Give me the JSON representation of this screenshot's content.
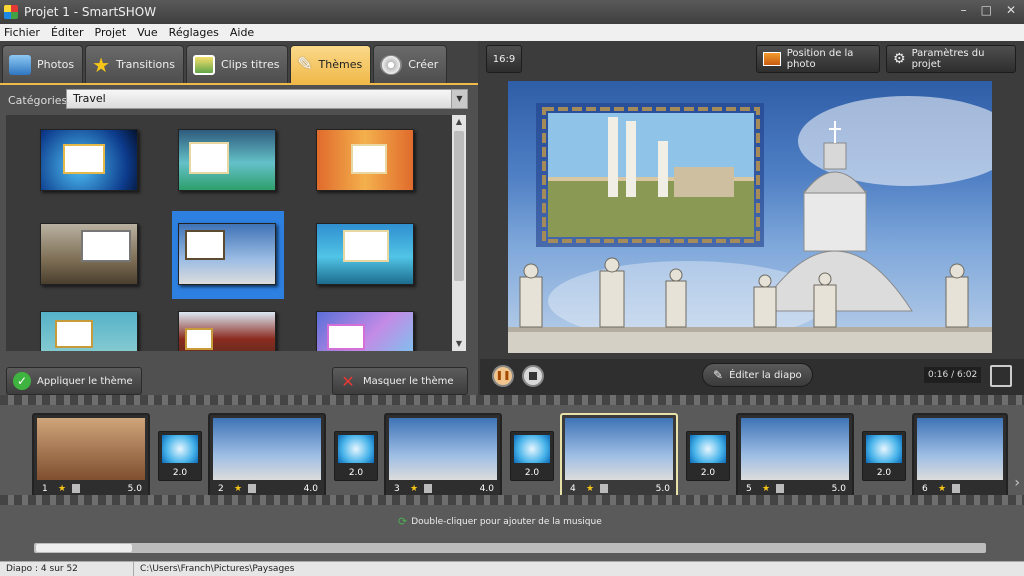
{
  "window": {
    "title": "Projet 1 - SmartSHOW",
    "controls": [
      "–",
      "□",
      "✕"
    ]
  },
  "menu": [
    "Fichier",
    "Éditer",
    "Projet",
    "Vue",
    "Réglages",
    "Aide"
  ],
  "tabs": [
    {
      "label": "Photos",
      "icon": "photos-icon",
      "color": "#4a90d9"
    },
    {
      "label": "Transitions",
      "icon": "star-icon",
      "color": "#f5c518"
    },
    {
      "label": "Clips titres",
      "icon": "clip-titles-icon",
      "color": "#62a64a"
    },
    {
      "label": "Thèmes",
      "icon": "brush-icon",
      "color": "#ffffff",
      "active": true
    },
    {
      "label": "Créer",
      "icon": "film-reel-icon",
      "color": "#cfcfcf"
    }
  ],
  "themes_panel": {
    "category_label": "Catégories",
    "category_value": "Travel",
    "apply_button": "Appliquer le thème",
    "hide_button": "Masquer le thème"
  },
  "preview": {
    "aspect_ratio": "16:9",
    "photo_position_button": "Position de la photo",
    "project_settings_button": "Paramètres du projet",
    "edit_slide_button": "Éditer la diapo",
    "time": "0:16 / 6:02"
  },
  "timeline": {
    "slides": [
      {
        "num": "1",
        "duration": "5.0",
        "active": false
      },
      {
        "num": "2",
        "duration": "4.0",
        "active": false
      },
      {
        "num": "3",
        "duration": "4.0",
        "active": false
      },
      {
        "num": "4",
        "duration": "5.0",
        "active": true
      },
      {
        "num": "5",
        "duration": "5.0",
        "active": false
      },
      {
        "num": "6",
        "duration": "",
        "active": false
      }
    ],
    "transitions": [
      "2.0",
      "2.0",
      "2.0",
      "2.0",
      "2.0"
    ],
    "music_hint": "Double-cliquer pour ajouter de la musique"
  },
  "status": {
    "slide_info": "Diapo : 4 sur 52",
    "path": "C:\\Users\\Franch\\Pictures\\Paysages"
  }
}
